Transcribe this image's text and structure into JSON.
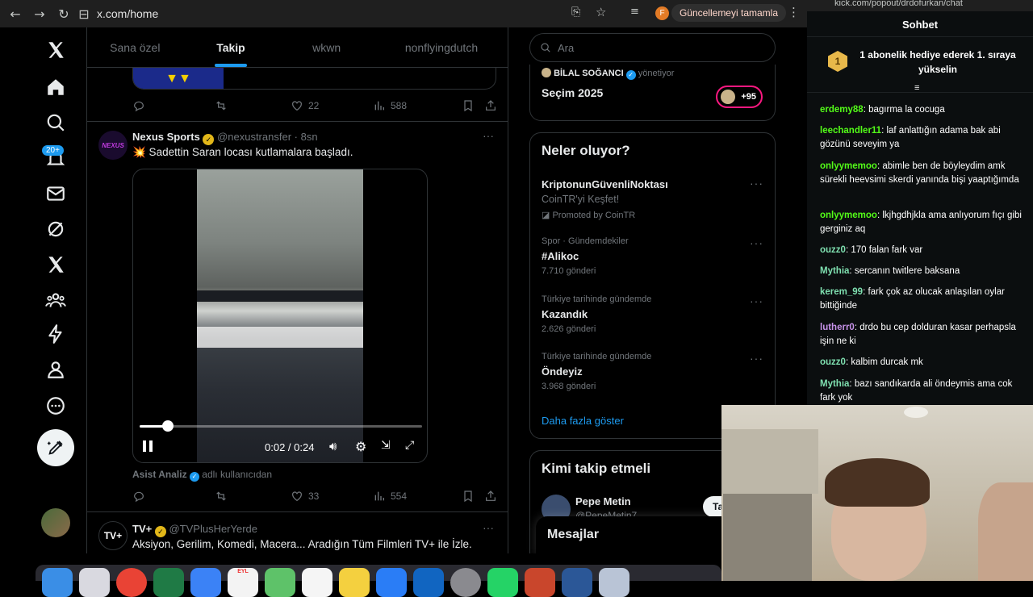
{
  "browser": {
    "url": "x.com/home",
    "update_label": "Güncellemeyi tamamla",
    "profile_letter": "F"
  },
  "nav": {
    "badge": "20+"
  },
  "feed": {
    "tabs": [
      "Sana özel",
      "Takip",
      "wkwn",
      "nonflyingdutch"
    ],
    "post_prev": {
      "likes": "22",
      "views": "588"
    },
    "post1": {
      "author": "Nexus Sports",
      "handle": "@nexustransfer",
      "time": "· 8sn",
      "avatar_text": "NEXUS",
      "text": "💥 Sadettin Saran locası kutlamalara başladı.",
      "video_time": "0:02 / 0:24",
      "video_progress": 0.1,
      "reposted_by": "Asist Analiz",
      "reposted_suffix": "adlı kullanıcıdan",
      "likes": "33",
      "views": "554"
    },
    "post2": {
      "author": "TV+",
      "handle": "@TVPlusHerYerde",
      "avatar_text": "TV+",
      "text": "Aksiyon, Gerilim, Komedi, Macera... Aradığın Tüm Filmleri TV+ ile İzle."
    }
  },
  "right": {
    "search_placeholder": "Ara",
    "space": {
      "host": "BİLAL SOĞANCI",
      "role": "yönetiyor",
      "title": "Seçim 2025",
      "count": "+95"
    },
    "trends_title": "Neler oluyor?",
    "trends": [
      {
        "meta": "",
        "name": "KriptonunGüvenliNoktası",
        "sub": "CoinTR'yi Keşfet!",
        "promo": "Promoted by CoinTR"
      },
      {
        "meta": "Spor · Gündemdekiler",
        "name": "#Alikoc",
        "sub": "7.710 gönderi"
      },
      {
        "meta": "Türkiye tarihinde gündemde",
        "name": "Kazandık",
        "sub": "2.626 gönderi"
      },
      {
        "meta": "Türkiye tarihinde gündemde",
        "name": "Öndeyiz",
        "sub": "3.968 gönderi"
      }
    ],
    "show_more": "Daha fazla göster",
    "follow_title": "Kimi takip etmeli",
    "follow_name": "Pepe Metin",
    "follow_handle": "@PepeMetin7",
    "follow_btn": "Ta",
    "messages_label": "Mesajlar"
  },
  "chat": {
    "url": "kick.com/popout/drdofurkan/chat",
    "title": "Sohbet",
    "pinned_rank": "1",
    "pinned": "1 abonelik hediye ederek 1. sıraya yükselin",
    "messages": [
      {
        "user": "erdemy88",
        "color": "#53fc18",
        "text": "bagırma la cocuga"
      },
      {
        "user": "leechandler11",
        "color": "#53fc18",
        "text": "laf anlattığın adama bak abi gözünü seveyim ya"
      },
      {
        "user": "onlyymemoo",
        "color": "#53fc18",
        "text": "abimle ben de böyleydim amk sürekli heevsimi skerdi yanında bişi yaaptığımda"
      },
      {
        "user": "onlyymemoo",
        "color": "#53fc18",
        "text": "lkjhgdhjkla ama anlıyorum fıçı gibi gerginiz aq"
      },
      {
        "user": "ouzz0",
        "color": "#7fe0b0",
        "text": "170 falan fark var"
      },
      {
        "user": "Mythia",
        "color": "#7fe0b0",
        "text": "sercanın twitlere baksana"
      },
      {
        "user": "kerem_99",
        "color": "#7fe0b0",
        "text": "fark çok az olucak anlaşılan oylar bittiğinde"
      },
      {
        "user": "lutherr0",
        "color": "#c792ea",
        "text": "drdo bu cep dolduran kasar perhapsla işin ne ki"
      },
      {
        "user": "ouzz0",
        "color": "#7fe0b0",
        "text": "kalbim durcak mk"
      },
      {
        "user": "Mythia",
        "color": "#7fe0b0",
        "text": "bazı sandıkarda ali öndeymis ama cok fark yok"
      }
    ]
  },
  "dock": {
    "calendar_month": "EYL"
  }
}
